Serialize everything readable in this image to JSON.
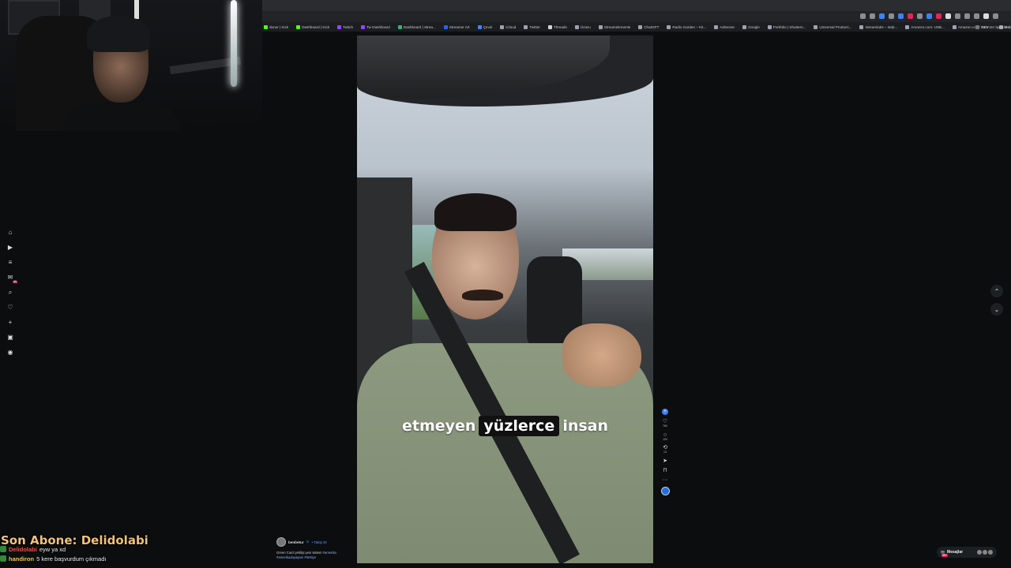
{
  "bookmarks": [
    {
      "label": "donor | Kick",
      "color": "#53fc18"
    },
    {
      "label": "Dashboard | Kick",
      "color": "#53fc18"
    },
    {
      "label": "Twitch",
      "color": "#9146ff"
    },
    {
      "label": "Tw Dashboard",
      "color": "#9146ff"
    },
    {
      "label": "Dashboard | Strea...",
      "color": "#3bb273"
    },
    {
      "label": "Streamer Art",
      "color": "#2563eb"
    },
    {
      "label": "Çeviri",
      "color": "#4285f4"
    },
    {
      "label": "iCloud",
      "color": "#9ca3af"
    },
    {
      "label": "Twitter",
      "color": "#9ca3af"
    },
    {
      "label": "Threads",
      "color": "#d1d5db"
    },
    {
      "label": "Ücüzu",
      "color": "#9ca3af"
    },
    {
      "label": "Streamelements",
      "color": "#9ca3af"
    },
    {
      "label": "ChatGPT",
      "color": "#9ca3af"
    },
    {
      "label": "Radio Garden – Kit...",
      "color": "#9ca3af"
    },
    {
      "label": "AdSense",
      "color": "#9ca3af"
    },
    {
      "label": "Google",
      "color": "#9ca3af"
    },
    {
      "label": "Portfolio | Shutters...",
      "color": "#9ca3af"
    },
    {
      "label": "Universal Producti...",
      "color": "#9ca3af"
    },
    {
      "label": "Streamlabs – stab...",
      "color": "#9ca3af"
    },
    {
      "label": "Amazon.com: USB...",
      "color": "#9ca3af"
    },
    {
      "label": "Amazon.com: NCV...",
      "color": "#9ca3af"
    },
    {
      "label": "Submit a request...",
      "color": "#9ca3af"
    },
    {
      "label": "Drive & Listen",
      "color": "#9ca3af"
    }
  ],
  "bookmarks_last": "Tüm Yer İşaretleri",
  "nav": [
    {
      "name": "home-icon",
      "glyph": "⌂"
    },
    {
      "name": "play-icon",
      "glyph": "▶"
    },
    {
      "name": "list-icon",
      "glyph": "≡"
    },
    {
      "name": "inbox-icon",
      "glyph": "✉",
      "badge": "99"
    },
    {
      "name": "search-icon",
      "glyph": "⌕"
    },
    {
      "name": "heart-icon",
      "glyph": "♡"
    },
    {
      "name": "plus-icon",
      "glyph": "+"
    },
    {
      "name": "reels-icon",
      "glyph": "▣"
    },
    {
      "name": "profile-icon",
      "glyph": "◉"
    }
  ],
  "video": {
    "caption_words": [
      "etmeyen",
      "yüzlerce",
      "insan"
    ]
  },
  "rail": {
    "follow_badge": "+",
    "share_glyph": "➤",
    "likes": "760",
    "comments": "120",
    "reposts": "13",
    "small_count": "14.4K"
  },
  "author": {
    "name": "benbetur",
    "verified": "⊙",
    "follow": "• Takip Et",
    "desc": "Green Card çekilişi yeni sistem",
    "tags": "#amerika #amerikadayaşam #türkiye"
  },
  "messages": {
    "label": "Mesajlar",
    "badge": "99+"
  },
  "stream": {
    "sub_banner": "Son Abone: Delidolabi",
    "chat": [
      {
        "user": "Delidolabi",
        "color": "#ff4a3d",
        "msg": "eyw ya xd"
      },
      {
        "user": "handiron",
        "color": "#f5c542",
        "msg": "5 kere başvurdum çıkmadı"
      }
    ]
  }
}
